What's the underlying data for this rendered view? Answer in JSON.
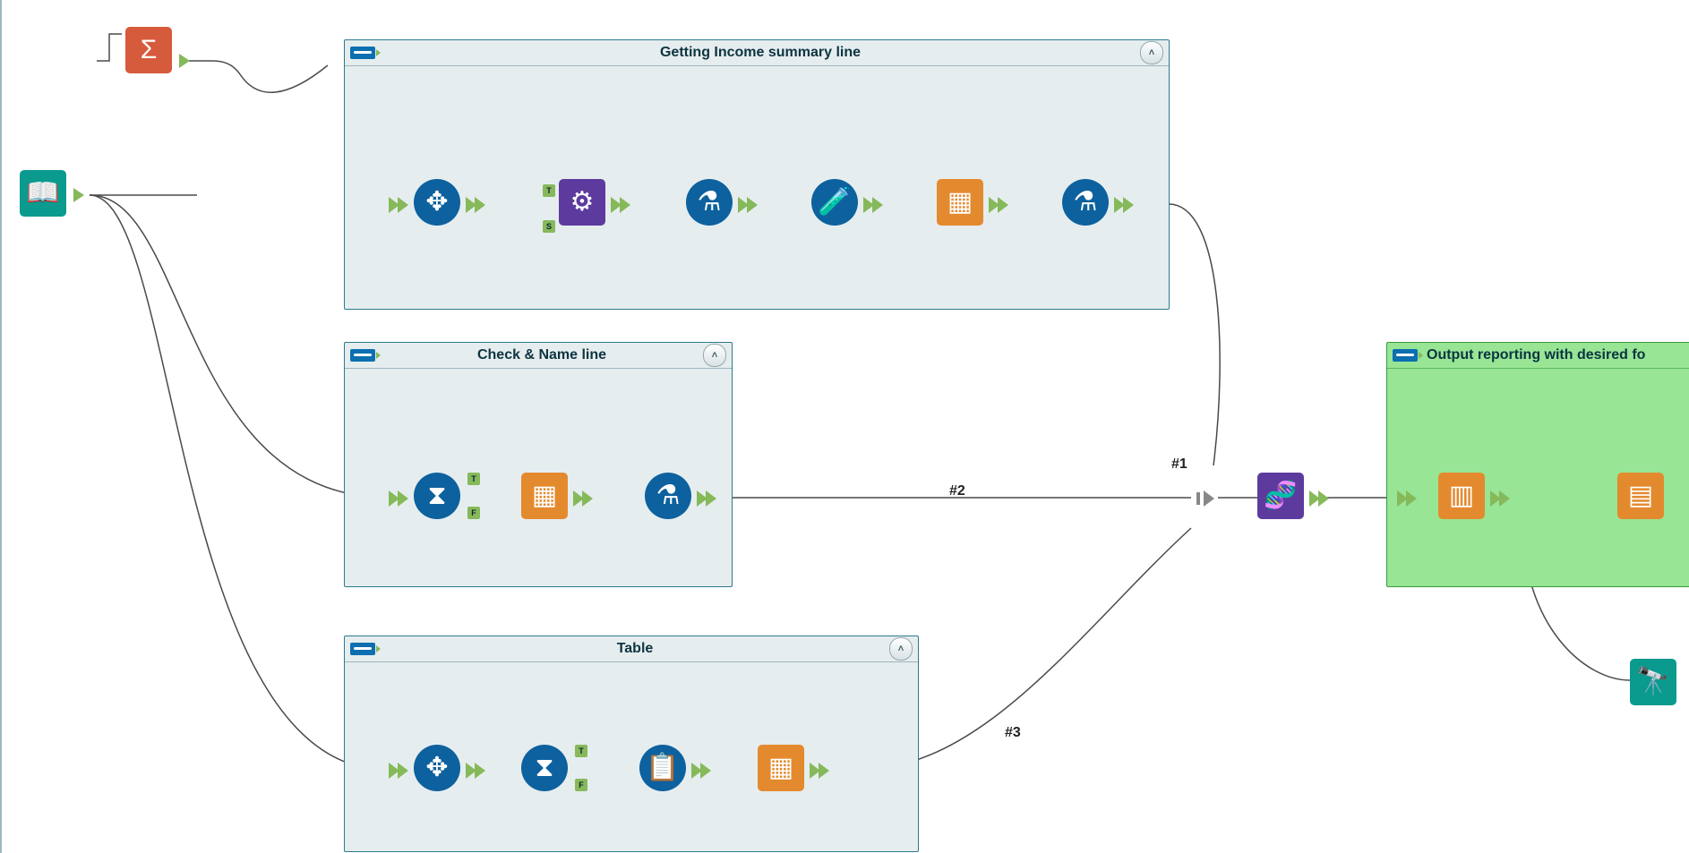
{
  "containers": {
    "income": {
      "title": "Getting Income summary line"
    },
    "check": {
      "title": "Check & Name line"
    },
    "table": {
      "title": "Table"
    },
    "output": {
      "title": "Output reporting with desired fo"
    }
  },
  "union_labels": {
    "one": "#1",
    "two": "#2",
    "three": "#3"
  },
  "tags": {
    "t": "T",
    "f": "F",
    "s": "S"
  },
  "icons": {
    "sigma": "Σ",
    "book": "📖",
    "move": "✥",
    "gears": "⚙",
    "flask": "⚗",
    "beaker": "🧪",
    "select": "▦",
    "filter": "⧗",
    "list": "📋",
    "dna": "🧬",
    "layout": "▥",
    "table": "▤",
    "binoc": "🔭",
    "chev": "˄"
  }
}
